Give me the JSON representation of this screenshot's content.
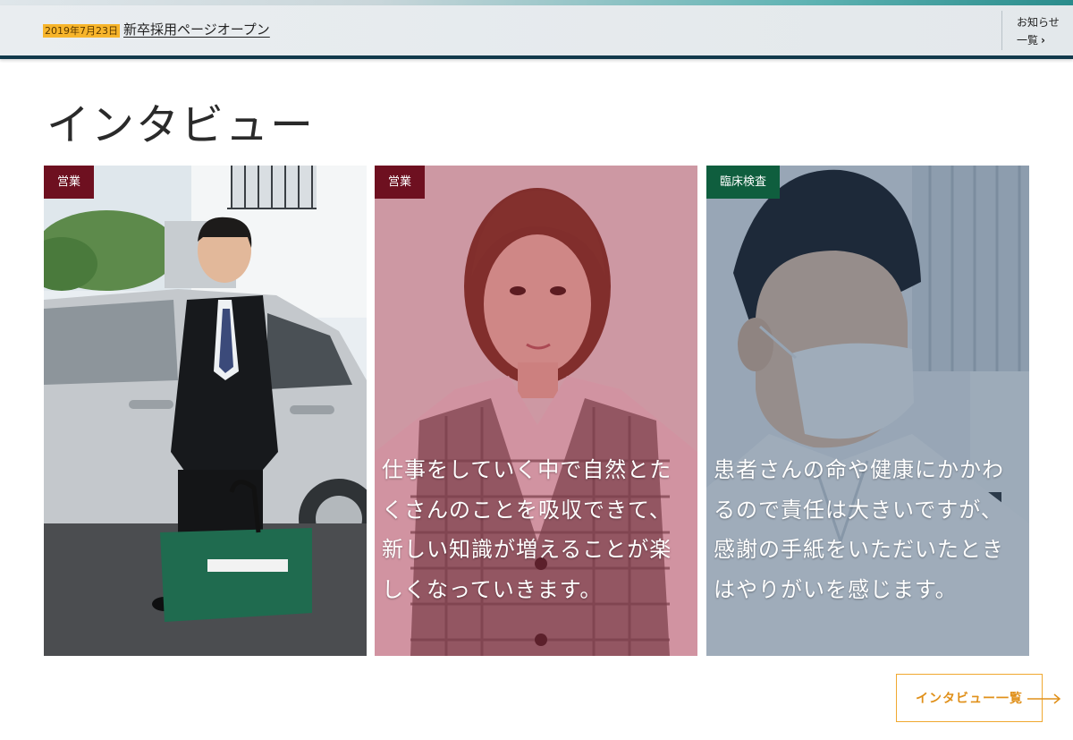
{
  "news": {
    "date": "2019年7月23日",
    "title": "新卒採用ページオープン",
    "list_line1": "お知らせ",
    "list_line2": "一覧",
    "list_chevron": "›"
  },
  "page": {
    "title": "インタビュー"
  },
  "interviews": [
    {
      "tag": "営業",
      "quote": ""
    },
    {
      "tag": "営業",
      "quote": "仕事をしていく中で自然とたくさんのことを吸収できて、新しい知識が増えることが楽しくなっていきます。"
    },
    {
      "tag": "臨床検査",
      "quote": "患者さんの命や健康にかかわるので責任は大きいですが、感謝の手紙をいただいたときはやりがいを感じます。"
    }
  ],
  "more_button": {
    "label": "インタビュー一覧"
  },
  "colors": {
    "accent": "#f0a830",
    "tag_sales": "#6e1020",
    "tag_lab": "#0f5e3e",
    "news_border": "#123a4c"
  }
}
